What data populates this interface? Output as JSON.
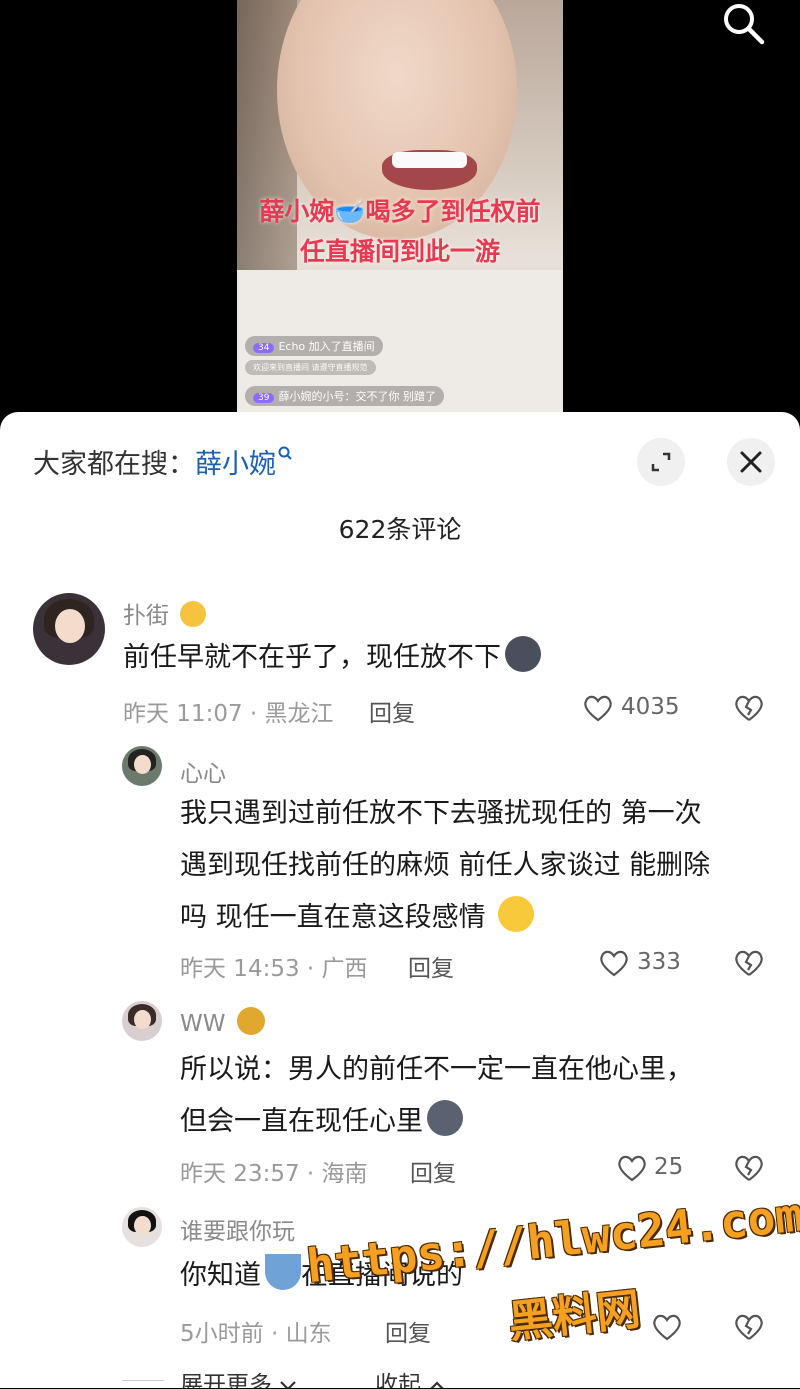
{
  "video": {
    "caption_line1": "薛小婉🥣喝多了到任权前",
    "caption_line2": "任直播间到此一游",
    "live_msgs": [
      {
        "badge": "34",
        "text": "Echo 加入了直播间"
      },
      {
        "badge": "",
        "text": "欢迎来到直播间 请遵守直播规范"
      },
      {
        "badge": "39",
        "text": "薛小婉的小号：交不了你 别蹭了"
      }
    ]
  },
  "header": {
    "hot_search_prefix": "大家都在搜：",
    "hot_search_keyword": "薛小婉",
    "comment_count": "622条评论"
  },
  "comments": [
    {
      "username": "扑街",
      "text": "前任早就不在乎了，现任放不下",
      "time": "昨天 11:07 · 黑龙江",
      "reply": "回复",
      "likes": "4035"
    },
    {
      "username": "心心",
      "text_lines": [
        "我只遇到过前任放不下去骚扰现任的 第一次",
        "遇到现任找前任的麻烦 前任人家谈过 能删除",
        "吗 现任一直在意这段感情"
      ],
      "time": "昨天 14:53 · 广西",
      "reply": "回复",
      "likes": "333"
    },
    {
      "username": "WW",
      "text_lines": [
        "所以说：男人的前任不一定一直在他心里，",
        "但会一直在现任心里"
      ],
      "time": "昨天 23:57 · 海南",
      "reply": "回复",
      "likes": "25"
    },
    {
      "username": "谁要跟你玩",
      "text": "你知道",
      "text_tail": "在直播间说的",
      "time": "5小时前 · 山东",
      "reply": "回复",
      "likes": ""
    }
  ],
  "footer": {
    "expand_more": "展开更多",
    "collapse": "收起"
  },
  "watermark": {
    "url": "https://hlwc24.com",
    "name": "黑料网"
  },
  "colors": {
    "accent_link": "#1a5fb0",
    "watermark": "#f5a020"
  }
}
